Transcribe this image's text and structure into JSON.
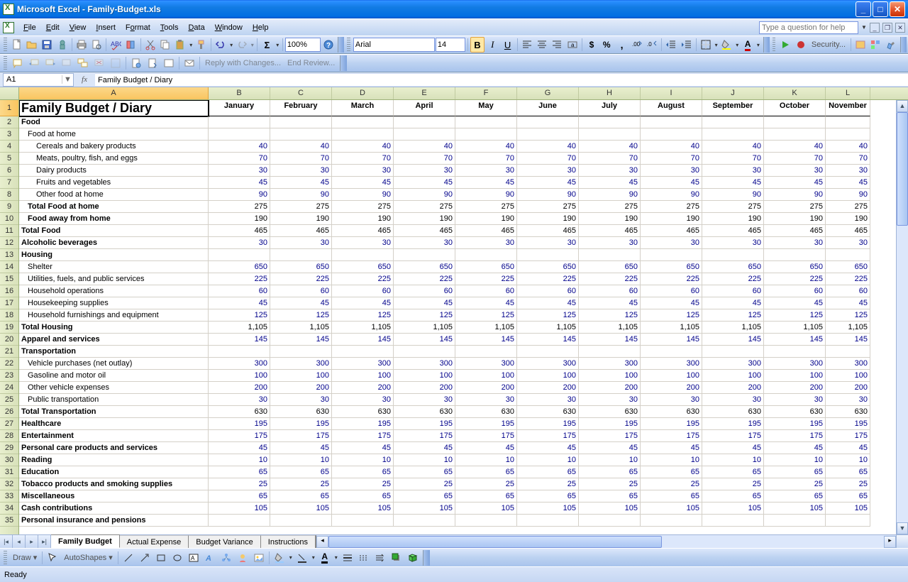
{
  "title": "Microsoft Excel - Family-Budget.xls",
  "menu": {
    "file": "File",
    "edit": "Edit",
    "view": "View",
    "insert": "Insert",
    "format": "Format",
    "tools": "Tools",
    "data": "Data",
    "window": "Window",
    "help": "Help"
  },
  "help_placeholder": "Type a question for help",
  "toolbar": {
    "zoom": "100%",
    "font_name": "Arial",
    "font_size": "14",
    "security": "Security...",
    "reply": "Reply with Changes...",
    "endreview": "End Review..."
  },
  "name_box": "A1",
  "formula": "Family Budget / Diary",
  "columns": [
    "A",
    "B",
    "C",
    "D",
    "E",
    "F",
    "G",
    "H",
    "I",
    "J",
    "K",
    "L"
  ],
  "months": [
    "January",
    "February",
    "March",
    "April",
    "May",
    "June",
    "July",
    "August",
    "September",
    "October",
    "November"
  ],
  "rows": [
    {
      "n": 1,
      "big": true,
      "label": "Family Budget / Diary",
      "type": "title",
      "hdr": true,
      "values": [
        "January",
        "February",
        "March",
        "April",
        "May",
        "June",
        "July",
        "August",
        "September",
        "October",
        "November"
      ]
    },
    {
      "n": 2,
      "label": "Food",
      "type": "section"
    },
    {
      "n": 3,
      "label": "Food at home",
      "type": "sub1"
    },
    {
      "n": 4,
      "label": "Cereals and bakery products",
      "type": "sub2",
      "v": 40,
      "last": "40"
    },
    {
      "n": 5,
      "label": "Meats, poultry, fish, and eggs",
      "type": "sub2",
      "v": 70,
      "last": "70"
    },
    {
      "n": 6,
      "label": "Dairy products",
      "type": "sub2",
      "v": 30,
      "last": "30"
    },
    {
      "n": 7,
      "label": "Fruits and vegetables",
      "type": "sub2",
      "v": 45,
      "last": "45"
    },
    {
      "n": 8,
      "label": "Other food at home",
      "type": "sub2",
      "v": 90,
      "last": "90"
    },
    {
      "n": 9,
      "label": "Total Food at home",
      "type": "total",
      "v": 275,
      "last": "275"
    },
    {
      "n": 10,
      "label": "Food away from home",
      "type": "total",
      "v": 190,
      "last": "190"
    },
    {
      "n": 11,
      "label": "Total Food",
      "type": "section",
      "v": 465,
      "last": "465"
    },
    {
      "n": 12,
      "label": "Alcoholic beverages",
      "type": "section",
      "v": 30,
      "blue": true,
      "last": "30"
    },
    {
      "n": 13,
      "label": "Housing",
      "type": "section"
    },
    {
      "n": 14,
      "label": "Shelter",
      "type": "sub1",
      "v": 650,
      "last": "650"
    },
    {
      "n": 15,
      "label": "Utilities, fuels, and public services",
      "type": "sub1",
      "v": 225,
      "last": "225"
    },
    {
      "n": 16,
      "label": "Household operations",
      "type": "sub1",
      "v": 60,
      "last": "60"
    },
    {
      "n": 17,
      "label": "Housekeeping supplies",
      "type": "sub1",
      "v": 45,
      "last": "45"
    },
    {
      "n": 18,
      "label": "Household furnishings and equipment",
      "type": "sub1",
      "v": 125,
      "last": "125"
    },
    {
      "n": 19,
      "label": "Total Housing",
      "type": "section",
      "v": "1,105",
      "last": "1,105"
    },
    {
      "n": 20,
      "label": "Apparel and services",
      "type": "section",
      "v": 145,
      "blue": true,
      "last": "145"
    },
    {
      "n": 21,
      "label": "Transportation",
      "type": "section"
    },
    {
      "n": 22,
      "label": "Vehicle purchases (net outlay)",
      "type": "sub1",
      "v": 300,
      "last": "300"
    },
    {
      "n": 23,
      "label": "Gasoline and motor oil",
      "type": "sub1",
      "v": 100,
      "last": "100"
    },
    {
      "n": 24,
      "label": "Other vehicle expenses",
      "type": "sub1",
      "v": 200,
      "last": "200"
    },
    {
      "n": 25,
      "label": "Public transportation",
      "type": "sub1",
      "v": 30,
      "last": "30"
    },
    {
      "n": 26,
      "label": "Total Transportation",
      "type": "section",
      "v": 630,
      "last": "630"
    },
    {
      "n": 27,
      "label": "Healthcare",
      "type": "section",
      "v": 195,
      "blue": true,
      "last": "195"
    },
    {
      "n": 28,
      "label": "Entertainment",
      "type": "section",
      "v": 175,
      "blue": true,
      "last": "175"
    },
    {
      "n": 29,
      "label": "Personal care products and services",
      "type": "section",
      "v": 45,
      "blue": true,
      "last": "45"
    },
    {
      "n": 30,
      "label": "Reading",
      "type": "section",
      "v": 10,
      "blue": true,
      "last": "10"
    },
    {
      "n": 31,
      "label": "Education",
      "type": "section",
      "v": 65,
      "blue": true,
      "last": "65"
    },
    {
      "n": 32,
      "label": "Tobacco products and smoking supplies",
      "type": "section",
      "v": 25,
      "blue": true,
      "last": "25"
    },
    {
      "n": 33,
      "label": "Miscellaneous",
      "type": "section",
      "v": 65,
      "blue": true,
      "last": "65"
    },
    {
      "n": 34,
      "label": "Cash contributions",
      "type": "section",
      "v": 105,
      "blue": true,
      "last": "105"
    },
    {
      "n": 35,
      "label": "Personal insurance and pensions",
      "type": "section"
    }
  ],
  "sheets": [
    "Family Budget",
    "Actual Expense",
    "Budget Variance",
    "Instructions"
  ],
  "active_sheet": 0,
  "draw_label": "Draw",
  "autoshapes": "AutoShapes",
  "status": "Ready"
}
